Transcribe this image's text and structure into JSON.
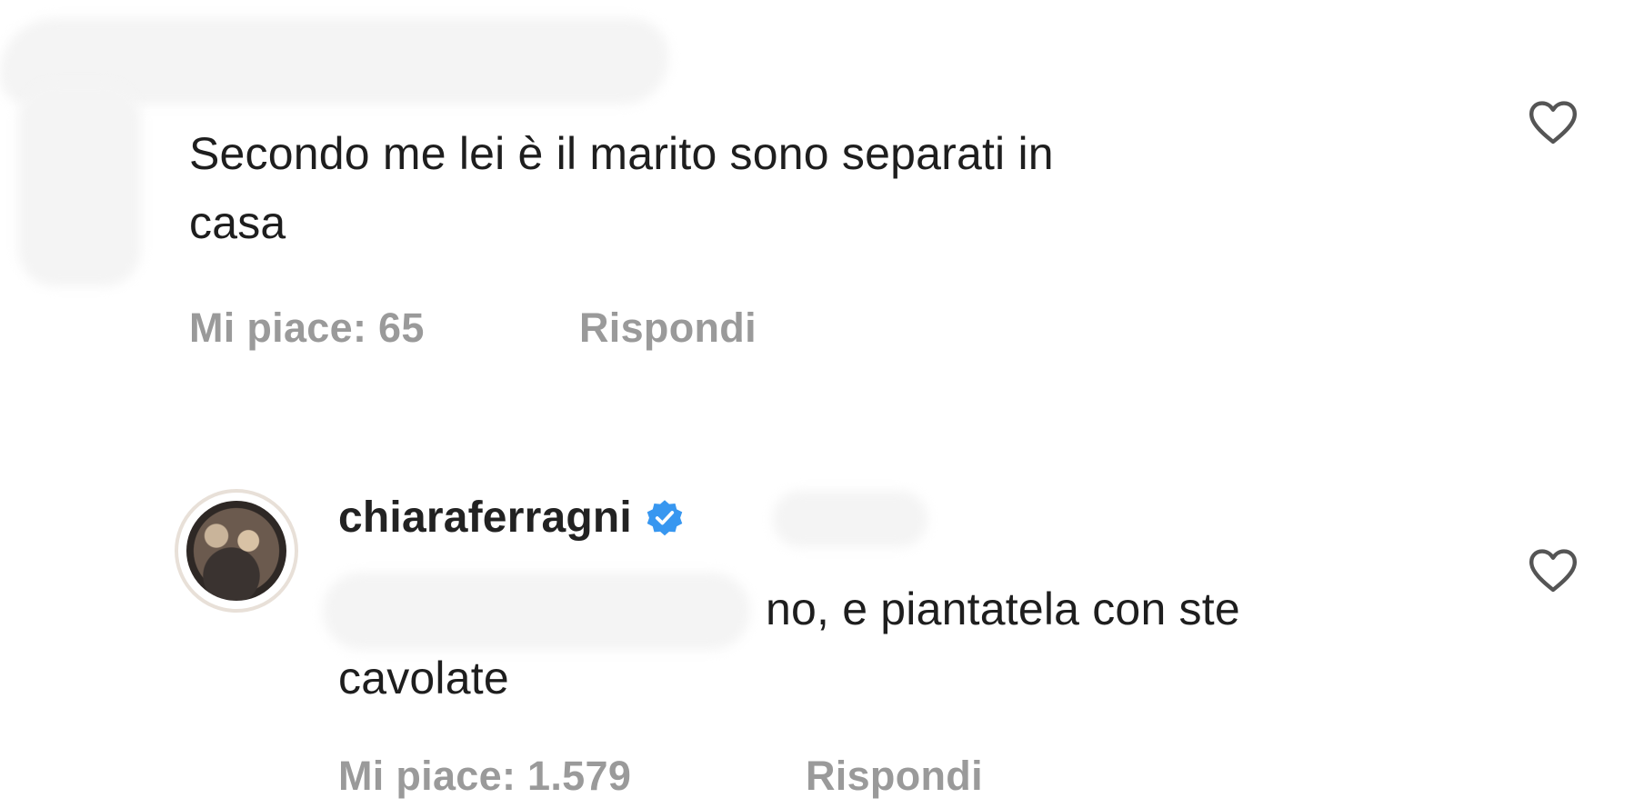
{
  "comments": [
    {
      "text_line1": "Secondo me lei è il marito sono separati in",
      "text_line2": "casa",
      "likes": "Mi piace: 65",
      "reply": "Rispondi"
    },
    {
      "username": "chiaraferragni",
      "verified": true,
      "text_line1": "no, e piantatela con ste",
      "text_line2": "cavolate",
      "likes": "Mi piace: 1.579",
      "reply": "Rispondi"
    }
  ],
  "icons": {
    "like": "heart-outline-icon",
    "verified": "verified-badge-icon"
  },
  "colors": {
    "text": "#1e1e1e",
    "meta": "#9a9a9a",
    "verified": "#3897f0",
    "redaction": "#f4f4f4"
  }
}
